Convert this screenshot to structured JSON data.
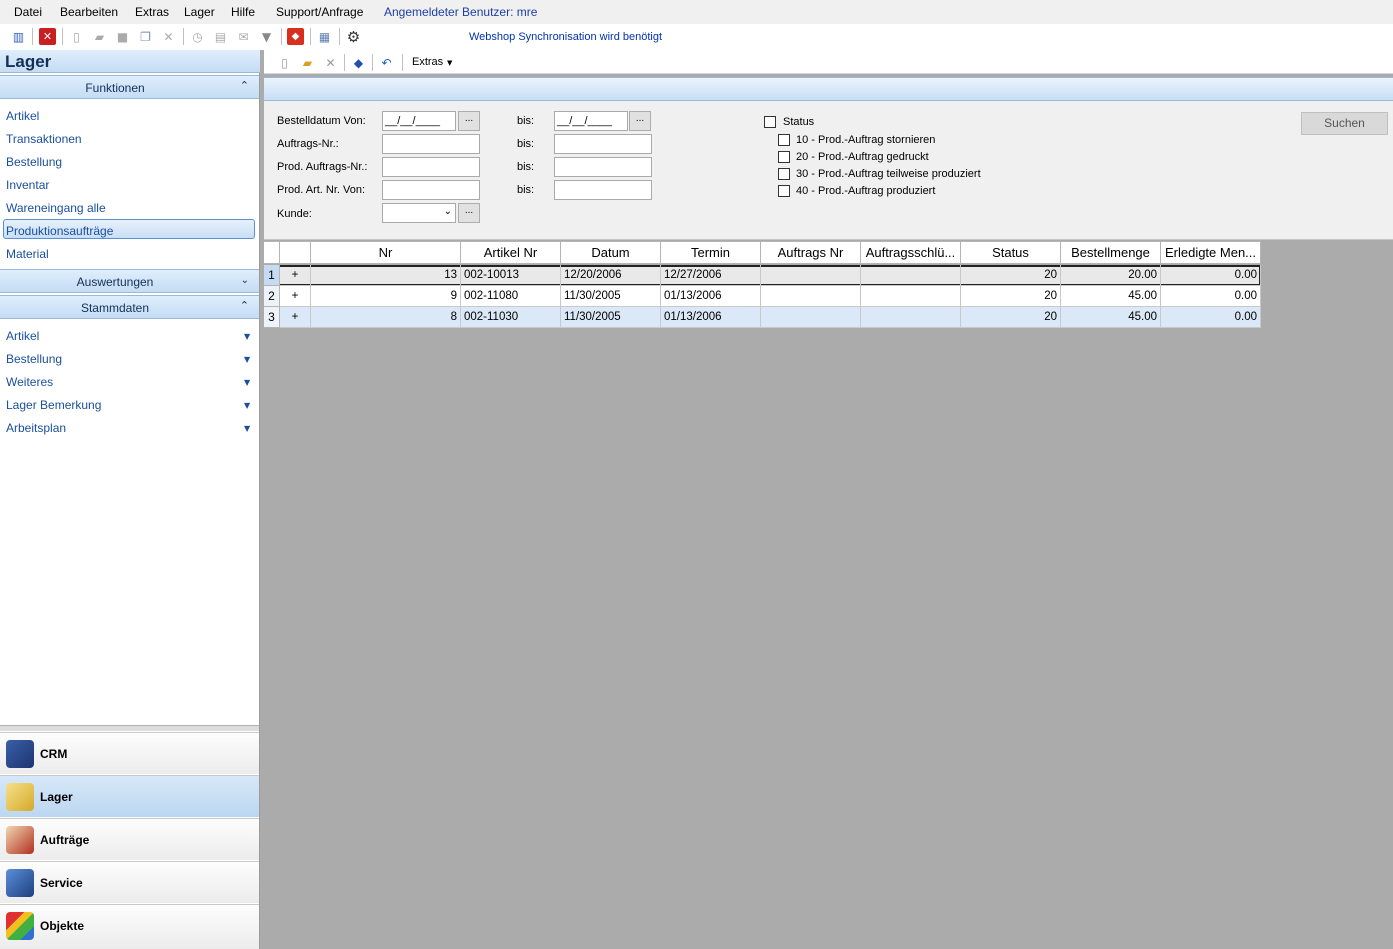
{
  "menubar": {
    "items": [
      "Datei",
      "Bearbeiten",
      "Extras",
      "Lager",
      "Hilfe",
      "Support/Anfrage"
    ],
    "user": "Angemeldeter Benutzer: mre"
  },
  "toolbar": {
    "webshop": "Webshop Synchronisation wird benötigt"
  },
  "left": {
    "title": "Lager",
    "sections": {
      "funktionen": "Funktionen",
      "auswertungen": "Auswertungen",
      "stammdaten": "Stammdaten"
    },
    "funktionen_items": [
      "Artikel",
      "Transaktionen",
      "Bestellung",
      "Inventar",
      "Wareneingang alle",
      "Produktionsaufträge",
      "Material"
    ],
    "stammdaten_items": [
      "Artikel",
      "Bestellung",
      "Weiteres",
      "Lager Bemerkung",
      "Arbeitsplan"
    ],
    "nav": [
      "CRM",
      "Lager",
      "Aufträge",
      "Service",
      "Objekte"
    ]
  },
  "main": {
    "toolbar": {
      "extras": "Extras"
    },
    "filter": {
      "bestelldatum_von": "Bestelldatum Von:",
      "date_value": "__/__/____",
      "bis": "bis:",
      "auftrags_nr": "Auftrags-Nr.:",
      "prod_auftrags_nr": "Prod. Auftrags-Nr.:",
      "prod_art_nr": "Prod. Art. Nr. Von:",
      "kunde": "Kunde:",
      "dots": "...",
      "status": "Status",
      "status_options": [
        "10 - Prod.-Auftrag stornieren",
        "20 - Prod.-Auftrag gedruckt",
        "30 - Prod.-Auftrag teilweise produziert",
        "40 - Prod.-Auftrag produziert"
      ],
      "search": "Suchen"
    },
    "grid": {
      "columns": [
        "Nr",
        "Artikel Nr",
        "Datum",
        "Termin",
        "Auftrags Nr",
        "Auftragsschlü...",
        "Status",
        "Bestellmenge",
        "Erledigte  Men..."
      ],
      "rows": [
        {
          "idx": "1",
          "exp": "+",
          "nr": "13",
          "artikel": "002-10013",
          "datum": "12/20/2006",
          "termin": "12/27/2006",
          "auftrag": "",
          "schluessel": "",
          "status": "20",
          "menge": "20.00",
          "erledigt": "0.00"
        },
        {
          "idx": "2",
          "exp": "+",
          "nr": "9",
          "artikel": "002-11080",
          "datum": "11/30/2005",
          "termin": "01/13/2006",
          "auftrag": "",
          "schluessel": "",
          "status": "20",
          "menge": "45.00",
          "erledigt": "0.00"
        },
        {
          "idx": "3",
          "exp": "+",
          "nr": "8",
          "artikel": "002-11030",
          "datum": "11/30/2005",
          "termin": "01/13/2006",
          "auftrag": "",
          "schluessel": "",
          "status": "20",
          "menge": "45.00",
          "erledigt": "0.00"
        }
      ]
    }
  }
}
